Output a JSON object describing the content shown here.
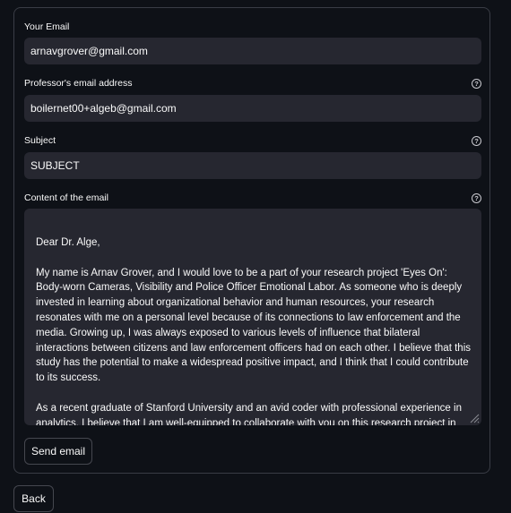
{
  "form": {
    "email": {
      "label": "Your Email",
      "value": "arnavgrover@gmail.com"
    },
    "professor_email": {
      "label": "Professor's email address",
      "value": "boilernet00+algeb@gmail.com",
      "help_icon": "question-circle-icon"
    },
    "subject": {
      "label": "Subject",
      "value": "SUBJECT",
      "help_icon": "question-circle-icon"
    },
    "content": {
      "label": "Content of the email",
      "help_icon": "question-circle-icon",
      "paragraphs": [
        "Dear Dr. Alge,",
        "My name is Arnav Grover, and I would love to be a part of your research project 'Eyes On': Body-worn Cameras, Visibility and Police Officer Emotional Labor. As someone who is deeply invested in learning about organizational behavior and human resources, your research resonates with me on a personal level because of its connections to law enforcement and the media. Growing up, I was always exposed to various levels of influence that bilateral interactions between citizens and law enforcement officers had on each other. I believe that this study has the potential to make a widespread positive impact, and I think that I could contribute to its success.",
        "As a recent graduate of Stanford University and an avid coder with professional experience in analytics, I believe that I am well-equipped to collaborate with you on this research project in meaningful ways. As a part of my time at the university, I obtained in-depth knowledge"
      ]
    },
    "send_label": "Send email"
  },
  "back_label": "Back",
  "colors": {
    "background": "#0e1117",
    "input_bg": "#262730",
    "border": "#3a3d46",
    "text": "#fafafa"
  }
}
